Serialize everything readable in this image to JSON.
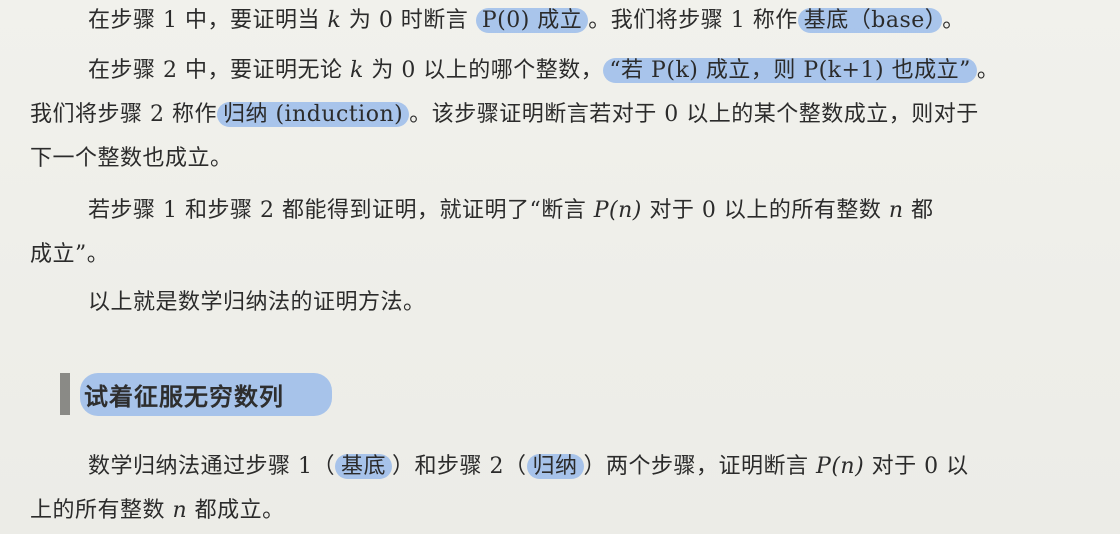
{
  "paragraphs": {
    "p1": {
      "seg1": "在步骤 1 中，要证明当 ",
      "k": "k",
      "seg2": " 为 0 时断言 ",
      "hl_p0": "P(0) 成立",
      "seg3": "。我们将步骤 1 称作",
      "hl_base": "基底（base）",
      "seg4": "。"
    },
    "p2": {
      "seg1": "在步骤 2 中，要证明无论 ",
      "k": "k",
      "seg2": " 为 0 以上的哪个整数，",
      "hl_quote": "“若 P(k) 成立，则 P(k+1) 也成立”",
      "seg3": "。"
    },
    "p2b": {
      "seg1": "我们将步骤 2 称作",
      "hl_induction": "归纳 (induction)",
      "seg2": "。该步骤证明断言若对于 0 以上的某个整数成立，则对于"
    },
    "p2c": "下一个整数也成立。",
    "p3": {
      "seg1": "若步骤 1 和步骤 2 都能得到证明，就证明了“断言 ",
      "pn": "P(n)",
      "seg2": " 对于 0 以上的所有整数 ",
      "n": "n",
      "seg3": " 都"
    },
    "p3b": "成立”。",
    "p4": "以上就是数学归纳法的证明方法。",
    "heading": "试着征服无穷数列",
    "p5": {
      "seg1": "数学归纳法通过步骤 1（",
      "hl_base": "基底",
      "seg2": "）和步骤 2（",
      "hl_induction": "归纳",
      "seg3": "）两个步骤，证明断言 ",
      "pn": "P(n)",
      "seg4": " 对于 0 以"
    },
    "p5b": {
      "seg1": "上的所有整数 ",
      "n": "n",
      "seg2": " 都成立。"
    }
  },
  "colors": {
    "highlight": "#6ea0eb",
    "heading_bar": "#8a8a86",
    "page": "#eeeeea"
  }
}
